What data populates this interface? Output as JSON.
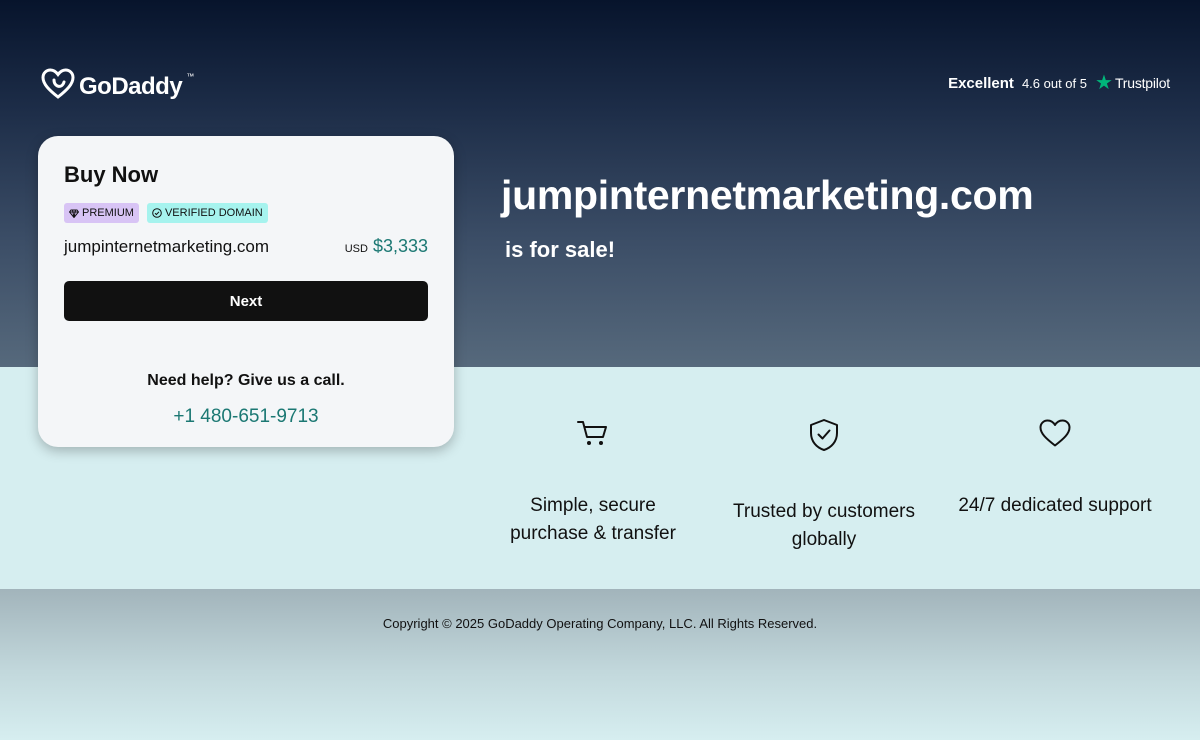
{
  "header": {
    "logo_text": "GoDaddy",
    "logo_tm": "™",
    "logo_icon": "godaddy-heart-icon"
  },
  "trustpilot": {
    "excellent": "Excellent",
    "rating": "4.6 out of 5",
    "brand": "Trustpilot",
    "star_icon": "star-icon",
    "star_color": "#00b67a"
  },
  "card": {
    "title": "Buy Now",
    "badges": {
      "premium": "PREMIUM",
      "premium_icon": "diamond-icon",
      "premium_color": "#d8c4f5",
      "verified": "VERIFIED DOMAIN",
      "verified_icon": "check-circle-icon",
      "verified_color": "#a6f3ee"
    },
    "domain": "jumpinternetmarketing.com",
    "currency": "USD",
    "price": "$3,333",
    "next_label": "Next",
    "help_text": "Need help? Give us a call.",
    "phone": "+1 480-651-9713"
  },
  "hero": {
    "domain": "jumpinternetmarketing.com",
    "sale_text": "is for sale!"
  },
  "features": [
    {
      "icon": "cart-icon",
      "line1": "Simple, secure",
      "line2": "purchase & transfer"
    },
    {
      "icon": "shield-check-icon",
      "line1": "Trusted by customers",
      "line2": "globally"
    },
    {
      "icon": "heart-icon",
      "line1": "24/7 dedicated support"
    }
  ],
  "footer": {
    "copyright": "Copyright © 2025 GoDaddy Operating Company, LLC. All Rights Reserved."
  },
  "colors": {
    "accent_teal": "#1b7873",
    "button_black": "#111111",
    "hero_top": "#07142c",
    "band_bg": "#d6eef0"
  }
}
